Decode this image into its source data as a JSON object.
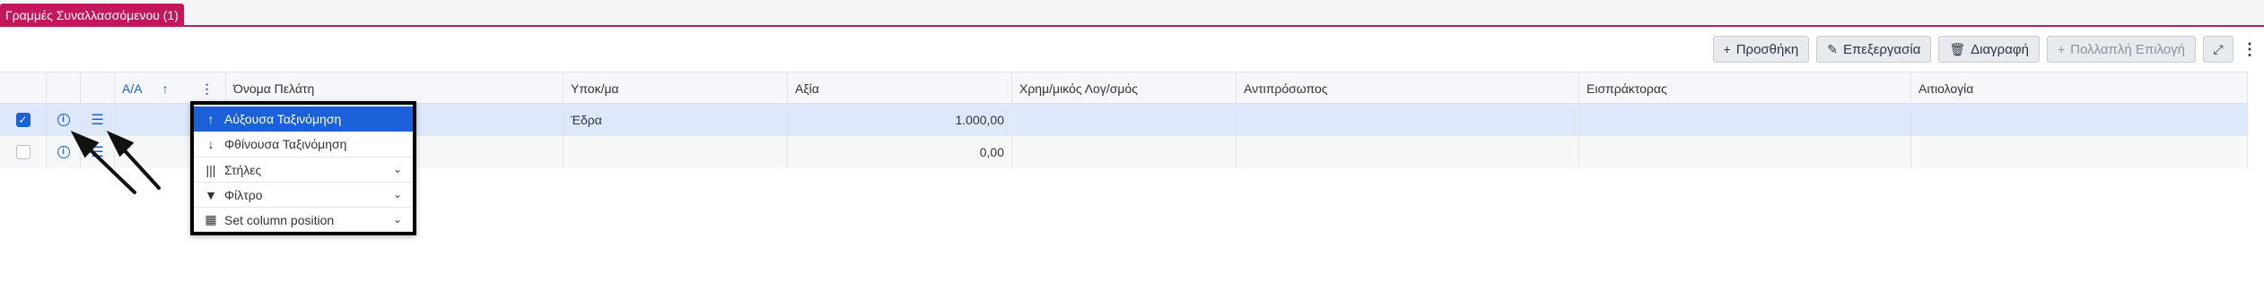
{
  "tab": {
    "label": "Γραμμές Συναλλασσόμενου (1)"
  },
  "toolbar": {
    "add": "Προσθήκη",
    "edit": "Επεξεργασία",
    "delete": "Διαγραφή",
    "multi": "Πολλαπλή Επιλογή"
  },
  "grid": {
    "headers": {
      "aa": "Α/Α",
      "customer": "Όνομα Πελάτη",
      "branch": "Υποκ/μα",
      "value": "Αξία",
      "account": "Χρημ/μικός Λογ/σμός",
      "representative": "Αντιπρόσωπος",
      "collector": "Εισπράκτορας",
      "reason": "Αιτιολογία"
    },
    "rows": [
      {
        "branch": "Έδρα",
        "value": "1.000,00",
        "selected": true
      },
      {
        "branch": "",
        "value": "0,00",
        "selected": false
      }
    ]
  },
  "context_menu": {
    "items": [
      {
        "label": "Αύξουσα Ταξινόμηση",
        "icon": "arrow-up-icon",
        "active": true
      },
      {
        "label": "Φθίνουσα Ταξινόμηση",
        "icon": "arrow-down-icon"
      },
      {
        "label": "Στήλες",
        "icon": "columns-icon",
        "expandable": true
      },
      {
        "label": "Φίλτρο",
        "icon": "filter-icon",
        "expandable": true
      },
      {
        "label": "Set column position",
        "icon": "table-icon",
        "expandable": true
      }
    ]
  },
  "colors": {
    "accent": "#c2185b",
    "primary": "#1b5fd9",
    "selected_row": "#dde9fa"
  }
}
